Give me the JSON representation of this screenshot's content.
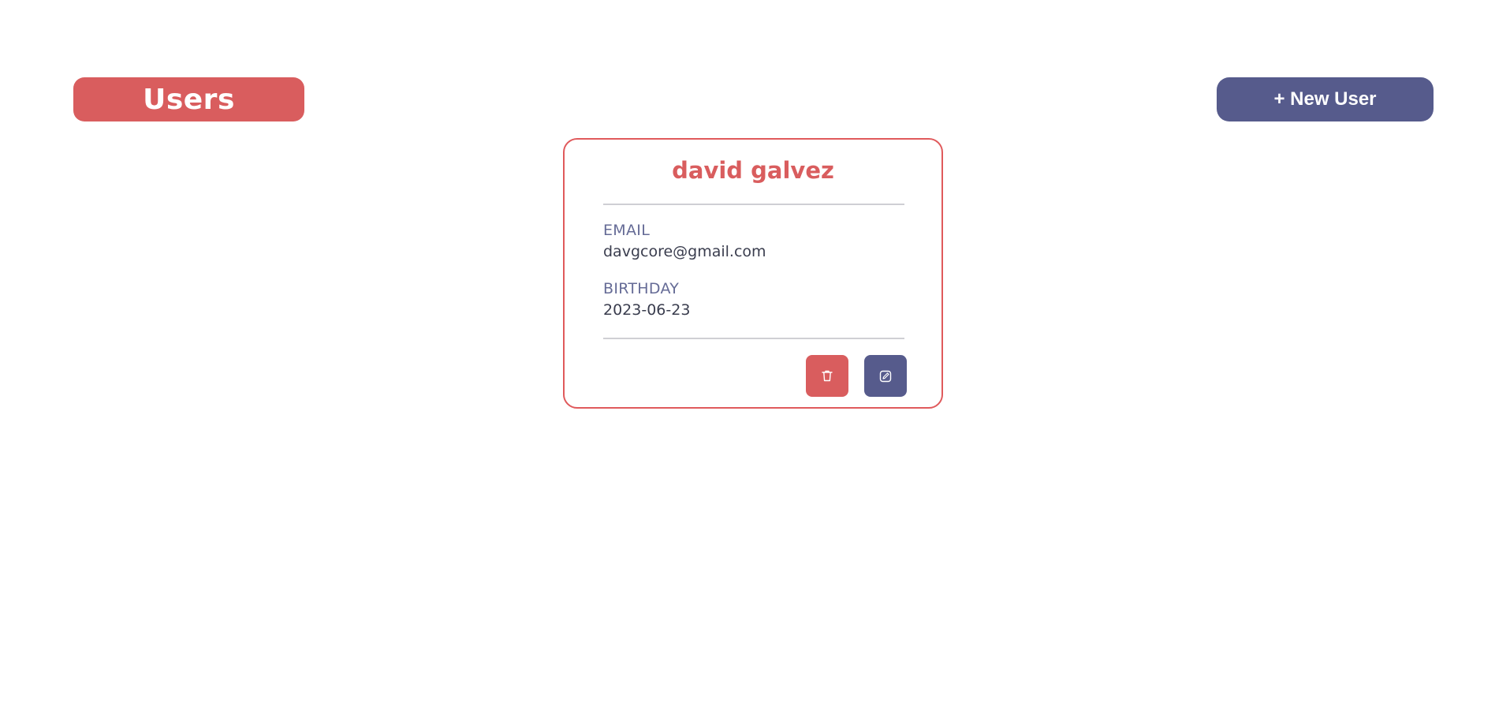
{
  "header": {
    "title": "Users",
    "new_user_label": "+ New User"
  },
  "user_card": {
    "name": "david galvez",
    "email_label": "EMAIL",
    "email": "davgcore@gmail.com",
    "birthday_label": "BIRTHDAY",
    "birthday": "2023-06-23",
    "delete_icon": "trash-icon",
    "edit_icon": "edit-icon"
  },
  "colors": {
    "accent_red": "#d95d5e",
    "accent_indigo": "#565b8c",
    "label_text": "#656b96",
    "value_text": "#3a3d4e"
  }
}
